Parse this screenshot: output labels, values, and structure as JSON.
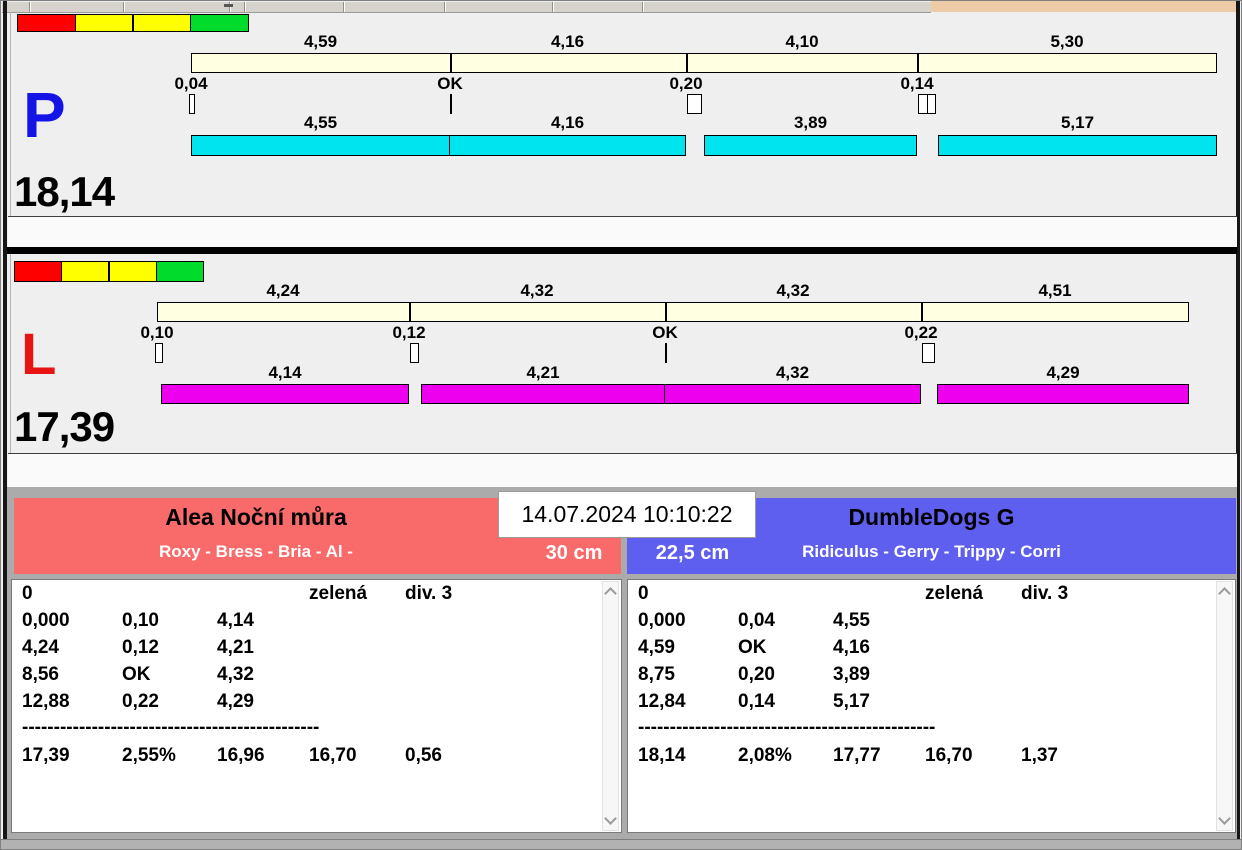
{
  "window": {
    "top_accent_color": "#EDCBA6",
    "background": "#EFEFEF"
  },
  "datetime": "14.07.2024 10:10:22",
  "lanes": [
    {
      "letter": "P",
      "letter_color": "#1414E6",
      "total": "18,14",
      "status_colors": [
        "#FF0000",
        "#FFFF00",
        "#FFFF00",
        "#00DB2C"
      ],
      "ref": {
        "color": "#FFFFE1",
        "labels": [
          "4,59",
          "4,16",
          "4,10",
          "5,30"
        ],
        "values": [
          4.59,
          4.16,
          4.1,
          5.3
        ]
      },
      "run": {
        "color": "#00E4EF",
        "labels": [
          "4,55",
          "4,16",
          "3,89",
          "5,17"
        ],
        "values": [
          4.55,
          4.16,
          3.89,
          5.17
        ]
      },
      "markers": [
        {
          "label": "0,04",
          "type": "box",
          "w": 6
        },
        {
          "label": "OK",
          "type": "line",
          "w": 2
        },
        {
          "label": "0,20",
          "type": "box",
          "w": 15
        },
        {
          "label": "0,14",
          "type": "box2",
          "w": 18
        }
      ]
    },
    {
      "letter": "L",
      "letter_color": "#E81414",
      "total": "17,39",
      "status_colors": [
        "#FF0000",
        "#FFFF00",
        "#FFFF00",
        "#00DB2C"
      ],
      "ref": {
        "color": "#FFFFE1",
        "labels": [
          "4,24",
          "4,32",
          "4,32",
          "4,51"
        ],
        "values": [
          4.24,
          4.32,
          4.32,
          4.51
        ]
      },
      "run": {
        "color": "#ED00ED",
        "labels": [
          "4,14",
          "4,21",
          "4,32",
          "4,29"
        ],
        "values": [
          4.14,
          4.21,
          4.32,
          4.29
        ]
      },
      "markers": [
        {
          "label": "0,10",
          "type": "box",
          "w": 8
        },
        {
          "label": "0,12",
          "type": "box",
          "w": 9
        },
        {
          "label": "OK",
          "type": "line",
          "w": 2
        },
        {
          "label": "0,22",
          "type": "box",
          "w": 13
        }
      ]
    }
  ],
  "teams": [
    {
      "name": "Alea Noční můra",
      "dogs": "Roxy - Bress - Bria - Al -",
      "height": "30 cm",
      "color": "#F96A6A",
      "table": {
        "rows": [
          [
            "0",
            "",
            "",
            "zelená",
            "div. 3"
          ],
          [
            "0,000",
            "0,10",
            "4,14",
            "",
            ""
          ],
          [
            "4,24",
            "0,12",
            "4,21",
            "",
            ""
          ],
          [
            "8,56",
            "OK",
            "4,32",
            "",
            ""
          ],
          [
            "12,88",
            "0,22",
            "4,29",
            "",
            ""
          ]
        ],
        "divider": "-----------------------------------------------",
        "total_row": [
          "17,39",
          "2,55%",
          "16,96",
          "16,70",
          "0,56"
        ]
      }
    },
    {
      "name": "DumbleDogs G",
      "dogs": "Ridiculus - Gerry - Trippy - Corri",
      "height": "22,5 cm",
      "color": "#5E5EEF",
      "table": {
        "rows": [
          [
            "0",
            "",
            "",
            "zelená",
            "div. 3"
          ],
          [
            "0,000",
            "0,04",
            "4,55",
            "",
            ""
          ],
          [
            "4,59",
            "OK",
            "4,16",
            "",
            ""
          ],
          [
            "8,75",
            "0,20",
            "3,89",
            "",
            ""
          ],
          [
            "12,84",
            "0,14",
            "5,17",
            "",
            ""
          ]
        ],
        "divider": "-----------------------------------------------",
        "total_row": [
          "18,14",
          "2,08%",
          "17,77",
          "16,70",
          "1,37"
        ]
      }
    }
  ]
}
